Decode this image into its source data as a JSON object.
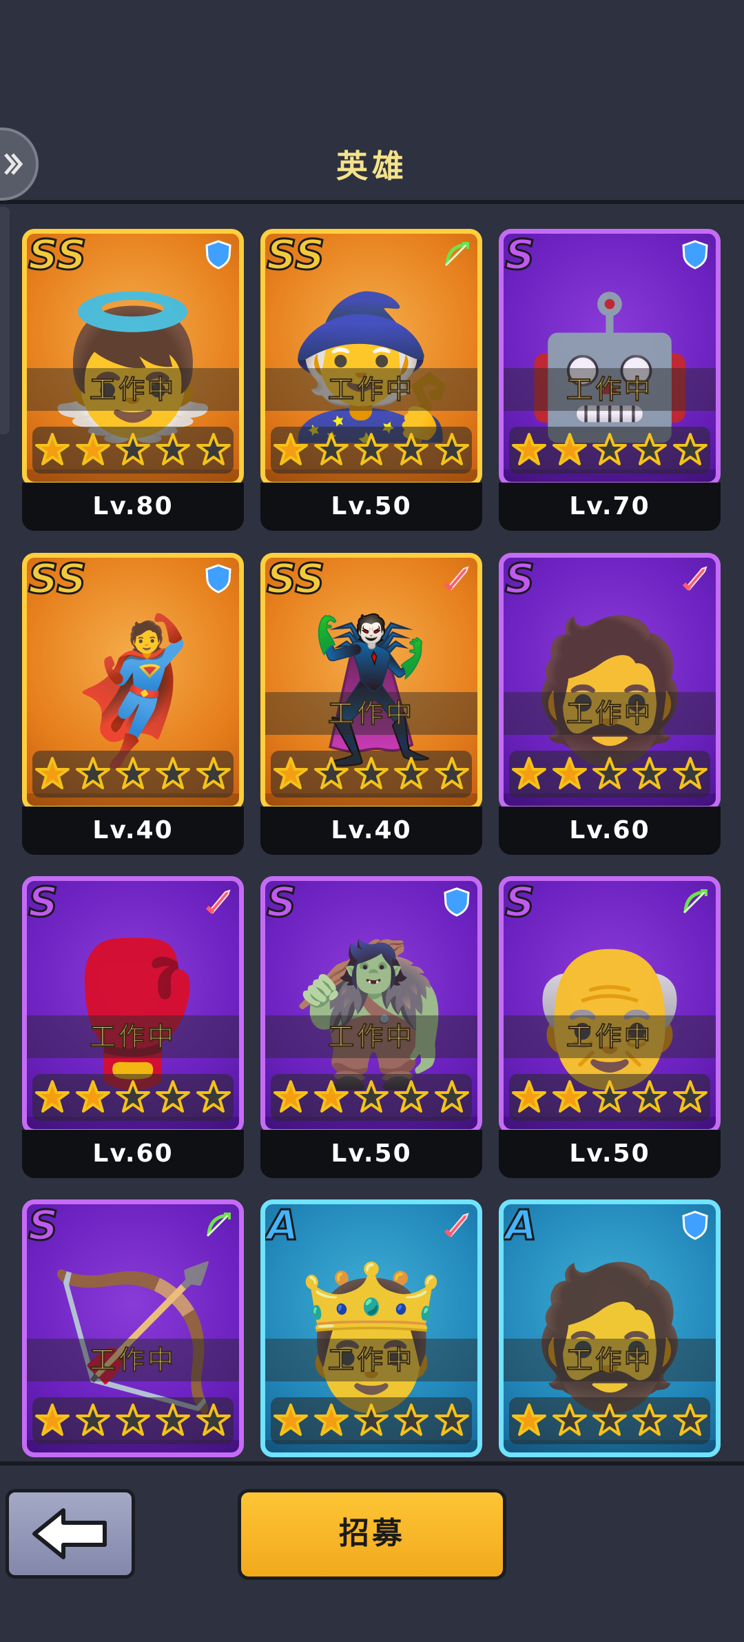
{
  "header": {
    "title": "英雄"
  },
  "heroes": [
    {
      "rank": "SS",
      "tier": "ss",
      "cls": "shield",
      "portrait": "👼",
      "status": "工作中",
      "stars_filled": 2,
      "level": "Lv.80"
    },
    {
      "rank": "SS",
      "tier": "ss",
      "cls": "bow",
      "portrait": "🧙",
      "status": "工作中",
      "stars_filled": 1,
      "level": "Lv.50"
    },
    {
      "rank": "S",
      "tier": "s",
      "cls": "shield",
      "portrait": "🤖",
      "status": "工作中",
      "stars_filled": 2,
      "level": "Lv.70"
    },
    {
      "rank": "SS",
      "tier": "ss",
      "cls": "shield",
      "portrait": "🦸",
      "status": "",
      "stars_filled": 1,
      "level": "Lv.40"
    },
    {
      "rank": "SS",
      "tier": "ss",
      "cls": "sword",
      "portrait": "🦹",
      "status": "工作中",
      "stars_filled": 1,
      "level": "Lv.40"
    },
    {
      "rank": "S",
      "tier": "s",
      "cls": "sword",
      "portrait": "🧔",
      "status": "工作中",
      "stars_filled": 2,
      "level": "Lv.60"
    },
    {
      "rank": "S",
      "tier": "s",
      "cls": "sword",
      "portrait": "🥊",
      "status": "工作中",
      "stars_filled": 2,
      "level": "Lv.60"
    },
    {
      "rank": "S",
      "tier": "s",
      "cls": "shield",
      "portrait": "🧌",
      "status": "工作中",
      "stars_filled": 2,
      "level": "Lv.50"
    },
    {
      "rank": "S",
      "tier": "s",
      "cls": "bow",
      "portrait": "👴",
      "status": "工作中",
      "stars_filled": 2,
      "level": "Lv.50"
    },
    {
      "rank": "S",
      "tier": "s",
      "cls": "bow",
      "portrait": "🏹",
      "status": "工作中",
      "stars_filled": 1,
      "level": ""
    },
    {
      "rank": "A",
      "tier": "a",
      "cls": "sword",
      "portrait": "🤴",
      "status": "工作中",
      "stars_filled": 2,
      "level": ""
    },
    {
      "rank": "A",
      "tier": "a",
      "cls": "shield",
      "portrait": "🧔",
      "status": "工作中",
      "stars_filled": 1,
      "level": ""
    }
  ],
  "class_colors": {
    "shield": "#3fa0ff",
    "bow": "#6fe24a",
    "sword": "#ff5b6e"
  },
  "star_colors": {
    "filled": "#f59e12",
    "empty": "#f4c21a"
  },
  "footer": {
    "back_icon": "arrow-left-icon",
    "recruit_label": "招募"
  }
}
